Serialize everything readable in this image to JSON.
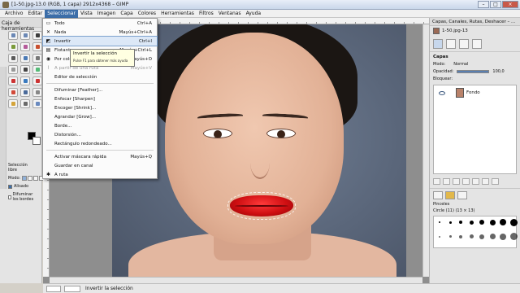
{
  "window": {
    "title": "[1-50.jpg-13.0 (RGB, 1 capa) 2912x4368 – GIMP",
    "buttons": [
      "–",
      "□",
      "×"
    ]
  },
  "menubar": [
    "Archivo",
    "Editar",
    "Seleccionar",
    "Vista",
    "Imagen",
    "Capa",
    "Colores",
    "Herramientas",
    "Filtros",
    "Ventanas",
    "Ayuda"
  ],
  "toolbox": {
    "title": "Caja de herramientas",
    "options_title": "Selección libre",
    "mode_label": "Modo:",
    "antialias_label": "Alisado",
    "feather_label": "Difuminar los bordes"
  },
  "select_menu": {
    "items": [
      {
        "icon": "select-all-icon",
        "glyph": "▭",
        "label": "Todo",
        "shortcut": "Ctrl+A"
      },
      {
        "icon": "select-none-icon",
        "glyph": "✕",
        "label": "Nada",
        "shortcut": "Mayús+Ctrl+A"
      },
      {
        "icon": "invert-icon",
        "glyph": "◩",
        "label": "Invertir",
        "shortcut": "Ctrl+I",
        "highlight": true
      },
      {
        "icon": "float-icon",
        "glyph": "▤",
        "label": "Flotante",
        "shortcut": "Mayús+Ctrl+L"
      },
      {
        "icon": "by-color-icon",
        "glyph": "◉",
        "label": "Por color",
        "shortcut": "Mayús+O"
      },
      {
        "icon": "from-path-icon",
        "glyph": "⌇",
        "label": "A partir de una ruta",
        "shortcut": "Mayús+V",
        "disabled": true
      },
      {
        "icon": "selection-editor-icon",
        "glyph": "",
        "label": "Editor de selección",
        "shortcut": ""
      },
      {
        "separator": true
      },
      {
        "icon": "feather-icon",
        "glyph": "",
        "label": "Difuminar [Feather]...",
        "shortcut": ""
      },
      {
        "icon": "sharpen-icon",
        "glyph": "",
        "label": "Enfocar [Sharpen]",
        "shortcut": ""
      },
      {
        "icon": "shrink-icon",
        "glyph": "",
        "label": "Encoger [Shrink]...",
        "shortcut": ""
      },
      {
        "icon": "grow-icon",
        "glyph": "",
        "label": "Agrandar [Grow]...",
        "shortcut": ""
      },
      {
        "icon": "border-icon",
        "glyph": "",
        "label": "Borde...",
        "shortcut": ""
      },
      {
        "icon": "distort-icon",
        "glyph": "",
        "label": "Distorsión...",
        "shortcut": ""
      },
      {
        "icon": "rounded-rect-icon",
        "glyph": "",
        "label": "Rectángulo redondeado...",
        "shortcut": ""
      },
      {
        "separator": true
      },
      {
        "icon": "quickmask-icon",
        "glyph": "",
        "label": "Activar máscara rápida",
        "shortcut": "Mayús+Q"
      },
      {
        "icon": "save-channel-icon",
        "glyph": "",
        "label": "Guardar en canal",
        "shortcut": ""
      },
      {
        "icon": "to-path-icon",
        "glyph": "✱",
        "label": "A ruta",
        "shortcut": ""
      }
    ]
  },
  "tooltip": {
    "title": "Invertir la selección",
    "hint": "Pulse F1 para obtener más ayuda"
  },
  "right_dock": {
    "title": "Capas, Canales, Rutas, Deshacer – ...",
    "image_name": "1-50.jpg-13",
    "layers_title": "Capas",
    "mode_label": "Modo:",
    "mode_value": "Normal",
    "opacity_label": "Opacidad:",
    "opacity_value": "100,0",
    "opacity_fraction": 1.0,
    "lock_label": "Bloquear:",
    "layer_name": "Fondo",
    "brushes_title": "Pinceles",
    "brush_info": "Circle (11) (13 × 13)"
  },
  "statusbar": {
    "text": "Invertir la selección"
  }
}
